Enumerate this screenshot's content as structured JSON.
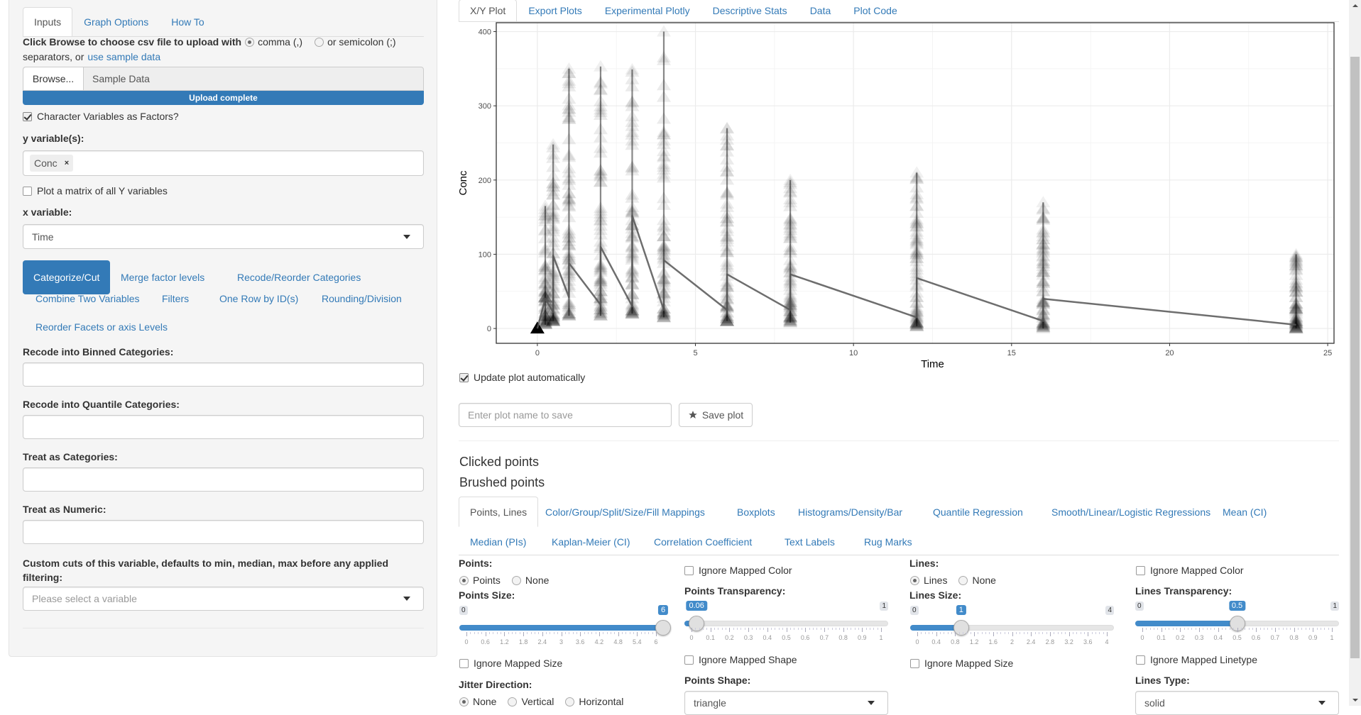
{
  "left": {
    "tabs": [
      {
        "label": "Inputs",
        "active": true
      },
      {
        "label": "Graph Options",
        "active": false
      },
      {
        "label": "How To",
        "active": false
      }
    ],
    "upload_prompt": "Click Browse to choose csv file to upload with",
    "sep_comma": "comma (,)",
    "sep_semicolon": "or semicolon (;)",
    "sep_suffix": "separators, or",
    "sample_link": "use sample data",
    "browse_label": "Browse...",
    "file_value": "Sample Data",
    "progress_label": "Upload complete",
    "progress_fraction": 1.0,
    "factors_label": "Character Variables as Factors?",
    "factors_checked": true,
    "y_label": "y variable(s):",
    "y_tags": [
      "Conc"
    ],
    "tag_remove": "×",
    "matrix_label": "Plot a matrix of all Y variables",
    "matrix_checked": false,
    "x_label": "x variable:",
    "x_value": "Time",
    "pills": [
      {
        "label": "Categorize/Cut",
        "active": true
      },
      {
        "label": "Merge factor levels",
        "active": false
      },
      {
        "label": "Recode/Reorder Categories",
        "active": false
      },
      {
        "label": "Combine Two Variables",
        "active": false
      },
      {
        "label": "Filters",
        "active": false
      },
      {
        "label": "One Row by ID(s)",
        "active": false
      },
      {
        "label": "Rounding/Division",
        "active": false
      },
      {
        "label": "Reorder Facets or axis Levels",
        "active": false
      }
    ],
    "fields": [
      {
        "label": "Recode into Binned Categories:",
        "value": ""
      },
      {
        "label": "Recode into Quantile Categories:",
        "value": ""
      },
      {
        "label": "Treat as Categories:",
        "value": ""
      },
      {
        "label": "Treat as Numeric:",
        "value": ""
      }
    ],
    "custom_cuts_label_1": "Custom cuts of this variable, defaults to min, median, max before any applied",
    "custom_cuts_label_2": "filtering:",
    "custom_cuts_placeholder": "Please select a variable"
  },
  "main": {
    "tabs": [
      {
        "label": "X/Y Plot",
        "active": true
      },
      {
        "label": "Export Plots",
        "active": false
      },
      {
        "label": "Experimental Plotly",
        "active": false
      },
      {
        "label": "Descriptive Stats",
        "active": false
      },
      {
        "label": "Data",
        "active": false
      },
      {
        "label": "Plot Code",
        "active": false
      }
    ],
    "update_auto_label": "Update plot automatically",
    "update_auto_checked": true,
    "plot_name_placeholder": "Enter plot name to save",
    "save_plot_label": "Save plot",
    "clicked_points": "Clicked points",
    "brushed_points": "Brushed points",
    "option_tabs_row1": [
      {
        "label": "Points, Lines",
        "active": true
      },
      {
        "label": "Color/Group/Split/Size/Fill Mappings",
        "active": false
      },
      {
        "label": "Boxplots",
        "active": false
      },
      {
        "label": "Histograms/Density/Bar",
        "active": false
      },
      {
        "label": "Quantile Regression",
        "active": false
      },
      {
        "label": "Smooth/Linear/Logistic Regressions",
        "active": false
      },
      {
        "label": "Mean (CI)",
        "active": false
      }
    ],
    "option_tabs_row2": [
      {
        "label": "Median (PIs)",
        "active": false
      },
      {
        "label": "Kaplan-Meier (CI)",
        "active": false
      },
      {
        "label": "Correlation Coefficient",
        "active": false
      },
      {
        "label": "Text Labels",
        "active": false
      },
      {
        "label": "Rug Marks",
        "active": false
      }
    ],
    "points": {
      "title": "Points:",
      "opt_points": "Points",
      "opt_none": "None",
      "selected": "Points",
      "size_label": "Points Size:",
      "size": {
        "min": 0,
        "max": 6,
        "value": 6,
        "ticks": [
          "0",
          "0.6",
          "1.2",
          "1.8",
          "2.4",
          "3",
          "3.6",
          "4.2",
          "4.8",
          "5.4",
          "6"
        ]
      },
      "ignore_size": "Ignore Mapped Size",
      "jitter_label": "Jitter Direction:",
      "jitter_options": [
        "None",
        "Vertical",
        "Horizontal"
      ],
      "jitter_selected": "None",
      "ignore_color": "Ignore Mapped Color",
      "transparency_label": "Points Transparency:",
      "transparency": {
        "min": 0,
        "max": 1,
        "value": 0.06,
        "ticks": [
          "0",
          "0.1",
          "0.2",
          "0.3",
          "0.4",
          "0.5",
          "0.6",
          "0.7",
          "0.8",
          "0.9",
          "1"
        ]
      },
      "ignore_shape": "Ignore Mapped Shape",
      "shape_label": "Points Shape:",
      "shape_value": "triangle"
    },
    "lines": {
      "title": "Lines:",
      "opt_lines": "Lines",
      "opt_none": "None",
      "selected": "Lines",
      "size_label": "Lines Size:",
      "size": {
        "min": 0,
        "max": 4,
        "value": 1,
        "ticks": [
          "0",
          "0.4",
          "0.8",
          "1.2",
          "1.6",
          "2",
          "2.4",
          "2.8",
          "3.2",
          "3.6",
          "4"
        ]
      },
      "ignore_size": "Ignore Mapped Size",
      "ignore_color": "Ignore Mapped Color",
      "transparency_label": "Lines Transparency:",
      "transparency": {
        "min": 0,
        "max": 1,
        "value": 0.5,
        "ticks": [
          "0",
          "0.1",
          "0.2",
          "0.3",
          "0.4",
          "0.5",
          "0.6",
          "0.7",
          "0.8",
          "0.9",
          "1"
        ]
      },
      "ignore_linetype": "Ignore Mapped Linetype",
      "type_label": "Lines Type:",
      "type_value": "solid"
    }
  },
  "colors": {
    "accent": "#337ab7",
    "slider": "#428bca",
    "point": "#000000",
    "line": "#555555"
  },
  "chart_data": {
    "type": "scatter",
    "title": "",
    "xlabel": "Time",
    "ylabel": "Conc",
    "xlim": [
      -1.3,
      25.2
    ],
    "ylim": [
      -20,
      412
    ],
    "xticks": [
      0,
      5,
      10,
      15,
      20,
      25
    ],
    "yticks": [
      0,
      100,
      200,
      300,
      400
    ],
    "grid": true,
    "point_shape": "triangle",
    "point_alpha": 0.06,
    "line_alpha": 0.5,
    "sampling_times": [
      0,
      0.25,
      0.5,
      1,
      2,
      3,
      4,
      6,
      8,
      12,
      16,
      24
    ],
    "column_ranges": [
      {
        "x": 0,
        "min": 0,
        "max": 0
      },
      {
        "x": 0.25,
        "min": 5,
        "max": 165
      },
      {
        "x": 0.5,
        "min": 10,
        "max": 248
      },
      {
        "x": 1,
        "min": 17,
        "max": 350
      },
      {
        "x": 2,
        "min": 17,
        "max": 353
      },
      {
        "x": 3,
        "min": 20,
        "max": 349
      },
      {
        "x": 4,
        "min": 15,
        "max": 400
      },
      {
        "x": 6,
        "min": 10,
        "max": 270
      },
      {
        "x": 8,
        "min": 8,
        "max": 200
      },
      {
        "x": 12,
        "min": 3,
        "max": 210
      },
      {
        "x": 16,
        "min": 0,
        "max": 170
      },
      {
        "x": 24,
        "min": 0,
        "max": 100
      }
    ],
    "profile_line": {
      "x": [
        0,
        0.25,
        0.5,
        0.5,
        1,
        1,
        2,
        2,
        3,
        3,
        4,
        4,
        6,
        6,
        8,
        8,
        12,
        12,
        16,
        16,
        24
      ],
      "y": [
        0,
        40,
        22,
        98,
        42,
        88,
        32,
        110,
        30,
        152,
        25,
        92,
        25,
        73,
        25,
        73,
        15,
        68,
        10,
        40,
        5
      ]
    }
  }
}
